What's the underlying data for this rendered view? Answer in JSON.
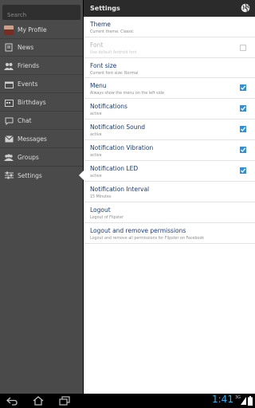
{
  "search": {
    "placeholder": "Search"
  },
  "menu": {
    "items": [
      {
        "label": "My Profile",
        "icon": "avatar"
      },
      {
        "label": "News",
        "icon": "news-icon"
      },
      {
        "label": "Friends",
        "icon": "friends-icon"
      },
      {
        "label": "Events",
        "icon": "events-icon"
      },
      {
        "label": "Birthdays",
        "icon": "birthdays-icon"
      },
      {
        "label": "Chat",
        "icon": "chat-icon"
      },
      {
        "label": "Messages",
        "icon": "messages-icon"
      },
      {
        "label": "Groups",
        "icon": "groups-icon"
      },
      {
        "label": "Settings",
        "icon": "settings-icon",
        "selected": true
      }
    ]
  },
  "settings": {
    "title": "Settings",
    "rows": [
      {
        "title": "Theme",
        "subtitle": "Current theme: Classic"
      },
      {
        "title": "Font",
        "subtitle": "Use default Android font",
        "disabled": true,
        "checkbox": false
      },
      {
        "title": "Font size",
        "subtitle": "Current font size: Normal"
      },
      {
        "title": "Menu",
        "subtitle": "Always show the menu on the left side",
        "checkbox": true
      },
      {
        "title": "Notifications",
        "subtitle": "active",
        "checkbox": true
      },
      {
        "title": "Notification Sound",
        "subtitle": "active",
        "checkbox": true
      },
      {
        "title": "Notification Vibration",
        "subtitle": "active",
        "checkbox": true
      },
      {
        "title": "Notification LED",
        "subtitle": "active",
        "checkbox": true
      },
      {
        "title": "Notification Interval",
        "subtitle": "15 Minutes"
      },
      {
        "title": "Logout",
        "subtitle": "Logout of Flipster"
      },
      {
        "title": "Logout and remove permissions",
        "subtitle": "Logout and remove all permissions for Flipster on Facebook"
      }
    ]
  },
  "statusbar": {
    "time": "1:41",
    "signal": "3G"
  },
  "colors": {
    "accent": "#33b5e5",
    "check": "#2f8fd8",
    "title_text": "#1a3b7a"
  }
}
